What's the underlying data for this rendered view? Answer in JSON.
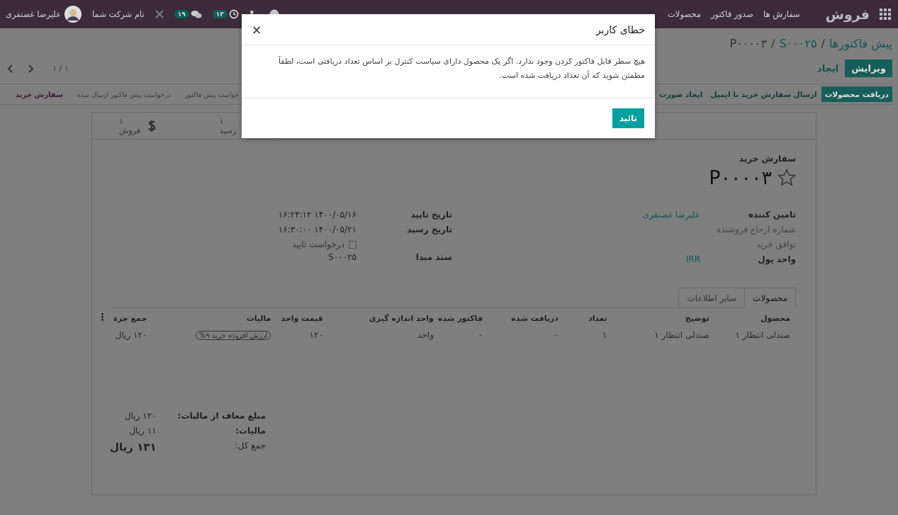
{
  "top_nav": {
    "app_name": "فروش",
    "menu": [
      "سفارش ها",
      "صدور فاکتور",
      "محصولات"
    ],
    "badges": [
      {
        "kind": "clock",
        "count": "۱۳"
      },
      {
        "kind": "chat",
        "count": "۱۹"
      }
    ],
    "company": "نام شرکت شما",
    "user": "علیرضا غضنفری"
  },
  "breadcrumb": {
    "separator": "/",
    "items": [
      "پیش فاکتورها",
      "S۰۰۰۲۵",
      "P۰۰۰۰۳"
    ]
  },
  "buttons": [
    {
      "label": "ویرایش",
      "kind": "primary"
    },
    {
      "label": "ایجاد",
      "kind": "secondary"
    }
  ],
  "pager": "۱ / ۱",
  "actions": [
    {
      "label": "دریافت محصولات",
      "kind": "primary"
    },
    {
      "label": "ارسال سفارش خرید با ایمیل",
      "kind": "secondary"
    },
    {
      "label": "ایجاد صورت",
      "kind": "secondary"
    }
  ],
  "status_steps": [
    {
      "label": "خواست پیش فاکتور",
      "selected": false
    },
    {
      "label": "درخواست پیش فاکتور ارسال شده",
      "selected": false
    },
    {
      "label": "سفارش خرید",
      "selected": true
    }
  ],
  "stat_buttons": [
    {
      "kind": "receipt",
      "value": "۱",
      "label": "رسید"
    },
    {
      "kind": "sales",
      "value": "۱",
      "label": "فروش"
    }
  ],
  "form": {
    "subtitle": "سفارش خرید",
    "name": "P۰۰۰۰۳",
    "starred": false,
    "right_fields": [
      {
        "label": "تامین کننده",
        "kind": "required",
        "value": "علیرضا غضنفری"
      },
      {
        "label": "شماره ارجاع فروشنده",
        "kind": "optional"
      },
      {
        "label": "توافق خرید",
        "kind": "optional"
      },
      {
        "label": "واحد پول",
        "kind": "required",
        "value": "IRR"
      }
    ],
    "left_fields": [
      {
        "label": "تاریخ تایید",
        "kind": "text",
        "value": "۱۴۰۰/۰۵/۱۶ ۱۶:۲۴:۱۲"
      },
      {
        "label": "تاریخ رسید",
        "kind": "text",
        "value": "۱۴۰۰/۰۵/۲۱ ۱۶:۳۰:۰۰"
      },
      {
        "label": "درخواست تایید",
        "kind": "checkbox",
        "checked": false
      },
      {
        "label": "سند مبدا",
        "kind": "text",
        "value": "S۰۰۰۲۵"
      }
    ]
  },
  "tabs": [
    {
      "label": "محصولات",
      "selected": true
    },
    {
      "label": "سایر اطلاعات",
      "selected": false
    }
  ],
  "table": {
    "columns": [
      "محصول",
      "توضیح",
      "تعداد",
      "دریافت شده",
      "فاکتور شده",
      "واحد اندازه گیری",
      "قیمت واحد",
      "مالیات",
      "جمع جزء"
    ],
    "rows": [
      {
        "product": "صندلی انتظار ۱",
        "description": "صندلی انتظار ۱",
        "quantity": "۱",
        "received": "۰",
        "invoiced": "۰",
        "uom": "واحد",
        "unit_price": "۱۲۰",
        "taxes": [
          "ارزش افزوده خرید ۹%"
        ],
        "subtotal": "۱۲۰ ریال"
      }
    ]
  },
  "totals": [
    {
      "label": "مبلغ معاف از مالیات:",
      "value": "۱۲۰ ریال",
      "kind": "line"
    },
    {
      "label": "مالیات:",
      "value": "۱۱ ریال",
      "kind": "line"
    },
    {
      "label": "جمع کل:",
      "value": "۱۳۱ ریال",
      "kind": "total"
    }
  ],
  "dialog": {
    "title": "خطای کاربر",
    "close": "×",
    "message": "هیچ سطر قابل فاکتور کردن وجود ندارد. اگر یک محصول دارای سیاست کنترل بر اساس تعداد دریافتی است، لطفاً مطمئن شوید که آن تعداد دریافت شده است.",
    "button": "تائید"
  }
}
